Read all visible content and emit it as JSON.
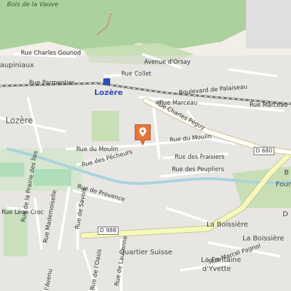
{
  "map": {
    "places": {
      "lozere_area": "Lozère",
      "station": "Lozère",
      "vauve_woods": "Bois de la Vauve",
      "paupiniaux": "aupiniaux",
      "quartier_suisse": "Quartier Suisse",
      "la_boissiere_1": "La Boissière",
      "la_boissiere_2": "La Boissière",
      "la_fontaine_line1": "La Fontaine",
      "la_fontaine_line2": "d'Yvette",
      "edge_b": "B",
      "edge_fourn": "Fourn",
      "edge_d": "D"
    },
    "roads": {
      "charles_gounod": "Rue Charles Gounod",
      "parmentier": "Rue Parmentier",
      "collet": "Rue Collet",
      "avenue_orsay": "Avenue d'Orsay",
      "marceau_1": "Rue Marceau",
      "marceau_2": "Rue Marceau",
      "bd_palaiseau": "Boulevard de Palaiseau",
      "charles_peguy": "Rue Charles Péguy",
      "moulin_1": "Rue du Moulin",
      "moulin_2": "Rue du Moulin",
      "pecheurs": "Rue des Pêcheurs",
      "fraisiers": "Rue des Fraisiers",
      "peupliers": "Rue des Peupliers",
      "provence": "Rue de Provence",
      "leon_croc": "Rue Léon Croc",
      "prairie_iles": "Rue de la Prairie des Îles",
      "mademoiselle": "Rue Mademoiselle",
      "savoie": "Rue de Savoie",
      "lausanne": "Rue de Lausanne",
      "marcel_pagnol": "Rue Marcel Pagnol",
      "oasis": "Rue de l'Oasis",
      "avenue_partial": "l'Avenu"
    },
    "road_refs": {
      "d680": "D 680",
      "d988": "D 988"
    },
    "icons": {
      "marker": "location-pin-icon",
      "station": "train-station-icon"
    },
    "colors": {
      "marker": "#e8743b",
      "primary_road": "#f6f9bd",
      "river": "#a9d3df",
      "woodland": "#add19e",
      "railway": "#555555"
    }
  }
}
